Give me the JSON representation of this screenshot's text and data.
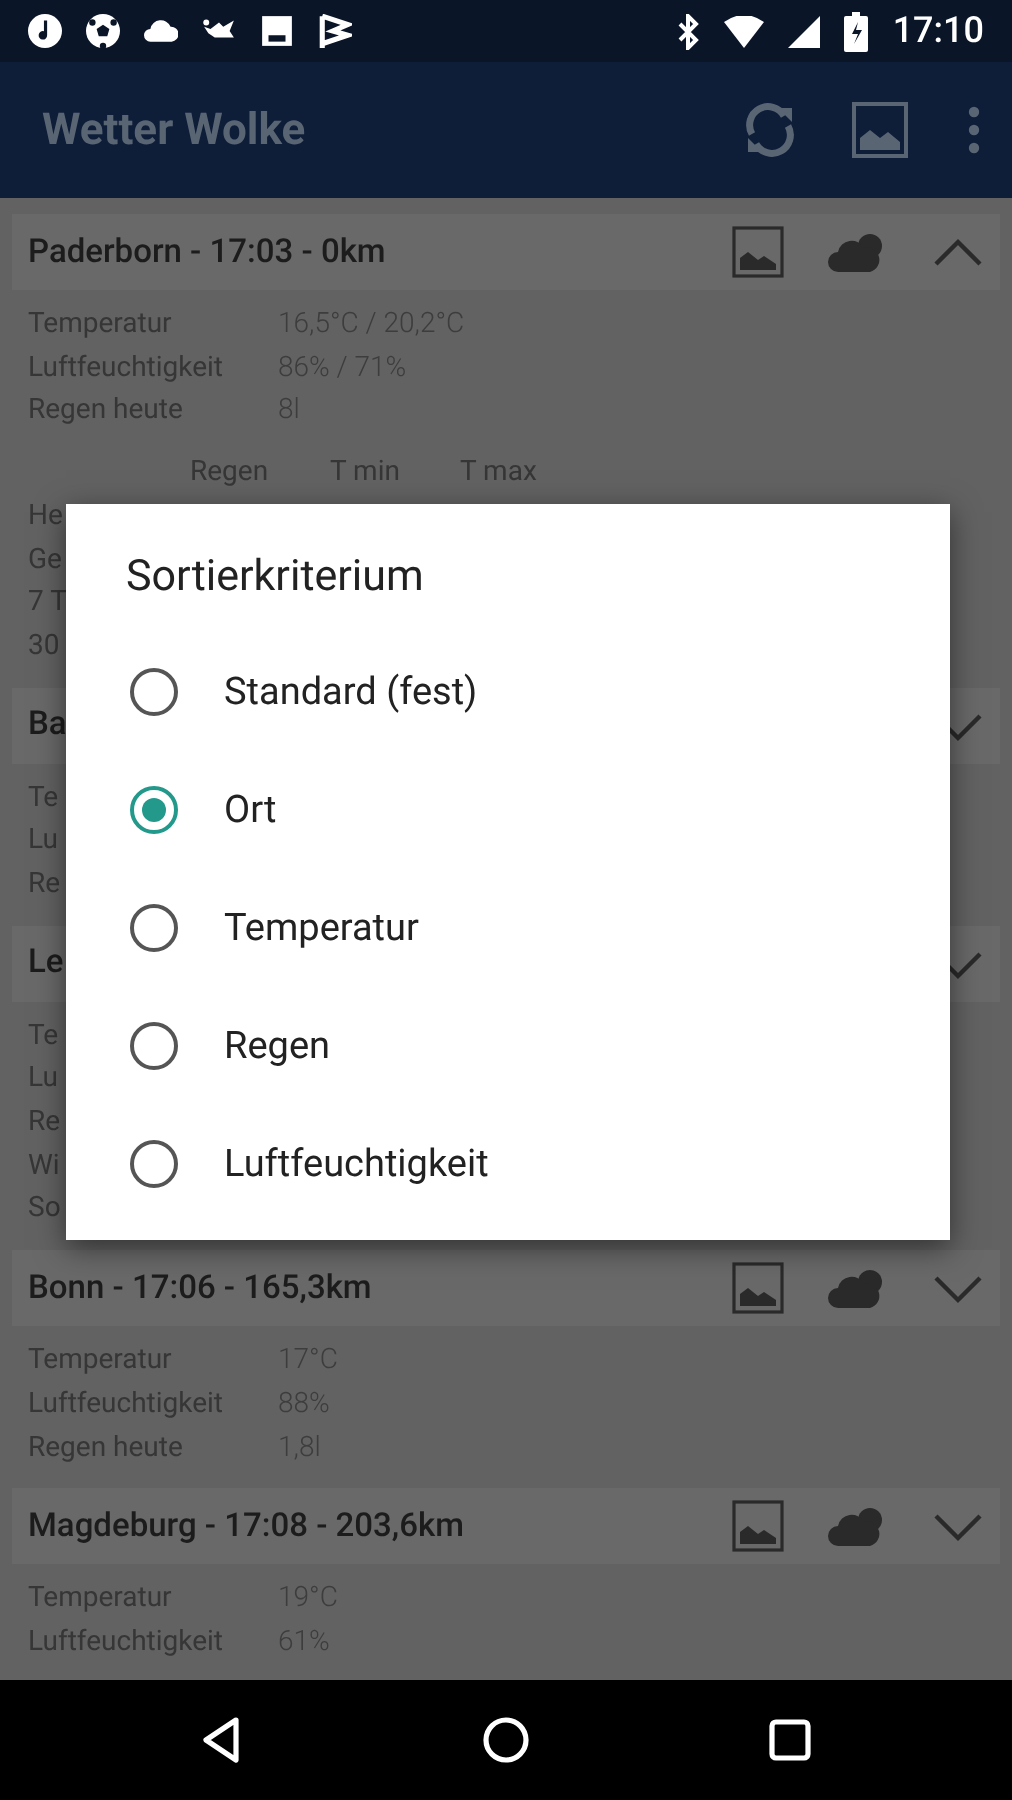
{
  "status_bar": {
    "time": "17:10"
  },
  "app_bar": {
    "title": "Wetter Wolke"
  },
  "cities": [
    {
      "title": "Paderborn - 17:03 - 0km",
      "expanded": true,
      "details": [
        {
          "label": "Temperatur",
          "value": "16,5°C / 20,2°C"
        },
        {
          "label": "Luftfeuchtigkeit",
          "value": "86% / 71%"
        },
        {
          "label": "Regen heute",
          "value": "8l"
        }
      ],
      "forecast": {
        "columns": [
          "Regen",
          "T min",
          "T max"
        ],
        "rows": [
          "He",
          "Ge",
          "7 T",
          "30"
        ]
      }
    },
    {
      "title": "Ba",
      "expanded": false,
      "details": [
        {
          "label": "Te"
        },
        {
          "label": "Lu"
        },
        {
          "label": "Re"
        }
      ]
    },
    {
      "title": "Le",
      "expanded": false,
      "details": [
        {
          "label": "Te"
        },
        {
          "label": "Lu"
        },
        {
          "label": "Re"
        },
        {
          "label": "Wi"
        },
        {
          "label": "So"
        }
      ]
    },
    {
      "title": "Bonn - 17:06 - 165,3km",
      "expanded": false,
      "details": [
        {
          "label": "Temperatur",
          "value": "17°C"
        },
        {
          "label": "Luftfeuchtigkeit",
          "value": "88%"
        },
        {
          "label": "Regen heute",
          "value": "1,8l"
        }
      ]
    },
    {
      "title": "Magdeburg - 17:08 - 203,6km",
      "expanded": false,
      "details": [
        {
          "label": "Temperatur",
          "value": "19°C"
        },
        {
          "label": "Luftfeuchtigkeit",
          "value": "61%"
        }
      ]
    }
  ],
  "sort_dialog": {
    "title": "Sortierkriterium",
    "options": [
      {
        "label": "Standard (fest)",
        "selected": false
      },
      {
        "label": "Ort",
        "selected": true
      },
      {
        "label": "Temperatur",
        "selected": false
      },
      {
        "label": "Regen",
        "selected": false
      },
      {
        "label": "Luftfeuchtigkeit",
        "selected": false
      }
    ]
  }
}
